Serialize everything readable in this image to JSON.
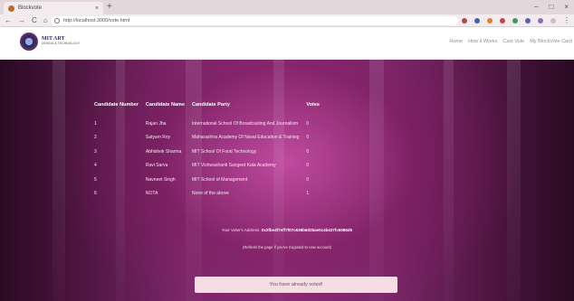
{
  "browser": {
    "tab_title": "Blockvote",
    "tab_close": "×",
    "new_tab": "+",
    "window_controls": [
      "–",
      "□",
      "×"
    ],
    "nav_buttons": [
      "←",
      "→",
      "C",
      "⌂"
    ],
    "url": "http://localhost:3000/vote.html",
    "menu": "⋮"
  },
  "site": {
    "logo_line1": "MIT ART",
    "logo_line2": "DESIGN & TECHNOLOGY",
    "nav": [
      "Home",
      "How it Works",
      "Cast Vote",
      "My BlockVote Card"
    ]
  },
  "table": {
    "headers": [
      "Candidate Number",
      "Candidate Name",
      "Candidate Party",
      "Votes"
    ],
    "rows": [
      [
        "1",
        "Rajan Jha",
        "International School Of Broadcasting And Journalism",
        "0"
      ],
      [
        "2",
        "Satyam Roy",
        "Maharashtra Academy Of Naval Education & Training",
        "0"
      ],
      [
        "3",
        "Abhishek Sharma",
        "MIT School Of Food Technology",
        "0"
      ],
      [
        "4",
        "Ravi Sarva",
        "MIT Vishwashanti Sangeet Kala Academy",
        "0"
      ],
      [
        "5",
        "Navneet Singh",
        "MIT School of Management",
        "0"
      ],
      [
        "6",
        "NOTA",
        "None of the above",
        "1"
      ]
    ]
  },
  "account": {
    "label": "Your Voter's Address:",
    "address": "0x2fbe4f7eff7f07c636b6d25ae0c4b437fc6086d0",
    "refresh_note": "(Refresh the page if you've migrated to new account)"
  },
  "status": {
    "message": "You have already voted!"
  }
}
